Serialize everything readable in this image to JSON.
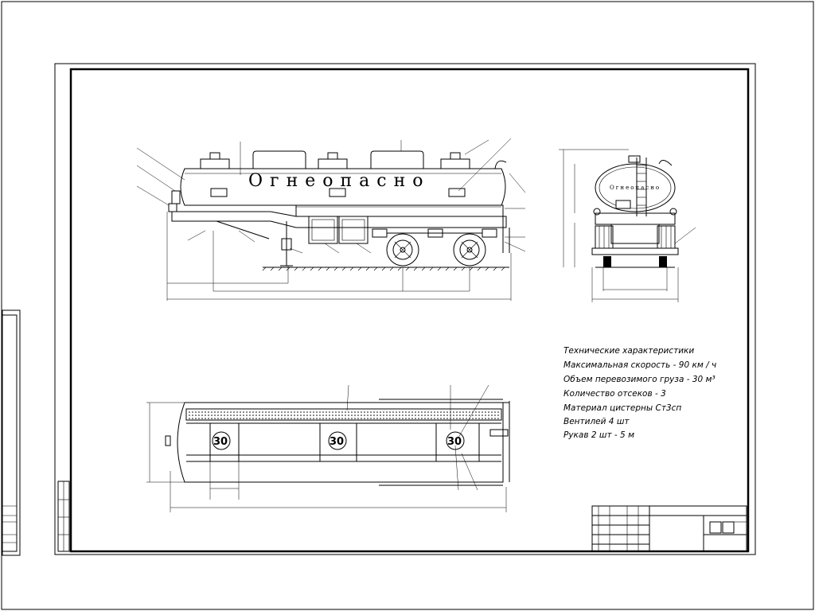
{
  "tank_lettering": "Огнеопасно",
  "specs": {
    "title": "Технические характеристики",
    "lines": [
      "Максимальная скорость - 90 км / ч",
      "Объем перевозимого груза - 30 м³",
      "Количество отсеков - 3",
      "Материал цистерны Ст3сп",
      "Вентилей 4 шт",
      "Рукав 2 шт - 5 м"
    ]
  },
  "axle_numbers": [
    "30",
    "30",
    "30"
  ]
}
